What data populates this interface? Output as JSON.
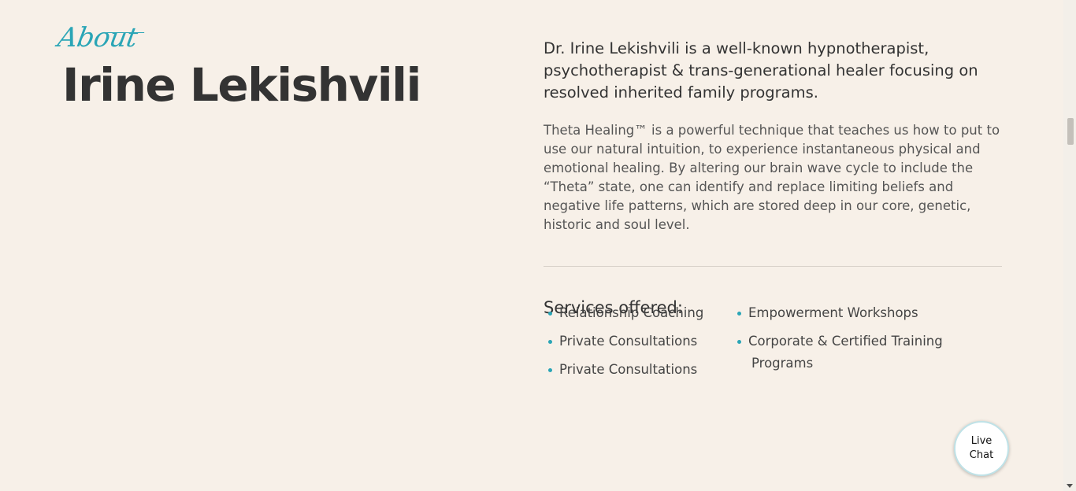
{
  "about": {
    "script_label": "About",
    "name": "Irine Lekishvili"
  },
  "intro": {
    "lead": "Dr. Irine Lekishvili is a well-known hypnotherapist, psychotherapist & trans-generational healer focusing on resolved inherited family programs.",
    "body": "Theta Healing™ is a powerful technique that teaches us how to put to use our natural intuition, to experience instantaneous physical and emotional healing. By altering our brain wave cycle to include the “Theta” state, one can identify and replace limiting beliefs and negative life patterns, which are stored deep in our core, genetic, historic and soul level."
  },
  "services": {
    "title": "Services offered:",
    "column1": [
      "Relationship Coaching",
      "Private Consultations",
      "Private Consultations"
    ],
    "column2": [
      "Empowerment Workshops",
      "Corporate & Certified Training Programs"
    ]
  },
  "live_chat": {
    "label": "Live Chat"
  },
  "colors": {
    "background": "#f7f0e8",
    "accent": "#2aa5b6",
    "heading": "#333333"
  }
}
